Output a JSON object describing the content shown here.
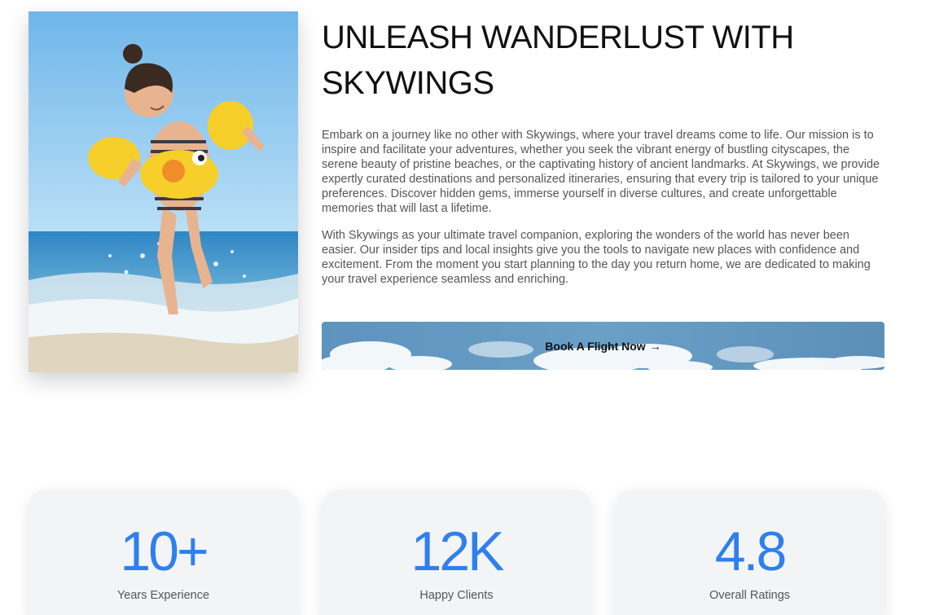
{
  "about": {
    "image_alt": "Child in yellow arm floats splashing in the sea",
    "heading": "UNLEASH WANDERLUST WITH SKYWINGS",
    "paragraph_1": "Embark on a journey like no other with Skywings, where your travel dreams come to life. Our mission is to inspire and facilitate your adventures, whether you seek the vibrant energy of bustling cityscapes, the serene beauty of pristine beaches, or the captivating history of ancient landmarks. At Skywings, we provide expertly curated destinations and personalized itineraries, ensuring that every trip is tailored to your unique preferences. Discover hidden gems, immerse yourself in diverse cultures, and create unforgettable memories that will last a lifetime.",
    "paragraph_2": "With Skywings as your ultimate travel companion, exploring the wonders of the world has never been easier. Our insider tips and local insights give you the tools to navigate new places with confidence and excitement. From the moment you start planning to the day you return home, we are dedicated to making your travel experience seamless and enriching.",
    "cta_label": "Book A Flight Now",
    "cta_icon": "arrow-right-icon"
  },
  "stats": [
    {
      "value": "10+",
      "label": "Years Experience"
    },
    {
      "value": "12K",
      "label": "Happy Clients"
    },
    {
      "value": "4.8",
      "label": "Overall Ratings"
    }
  ],
  "colors": {
    "accent": "#2f80ed",
    "heading": "#111111",
    "body_text": "#555555",
    "card_bg": "#f3f4f6"
  }
}
